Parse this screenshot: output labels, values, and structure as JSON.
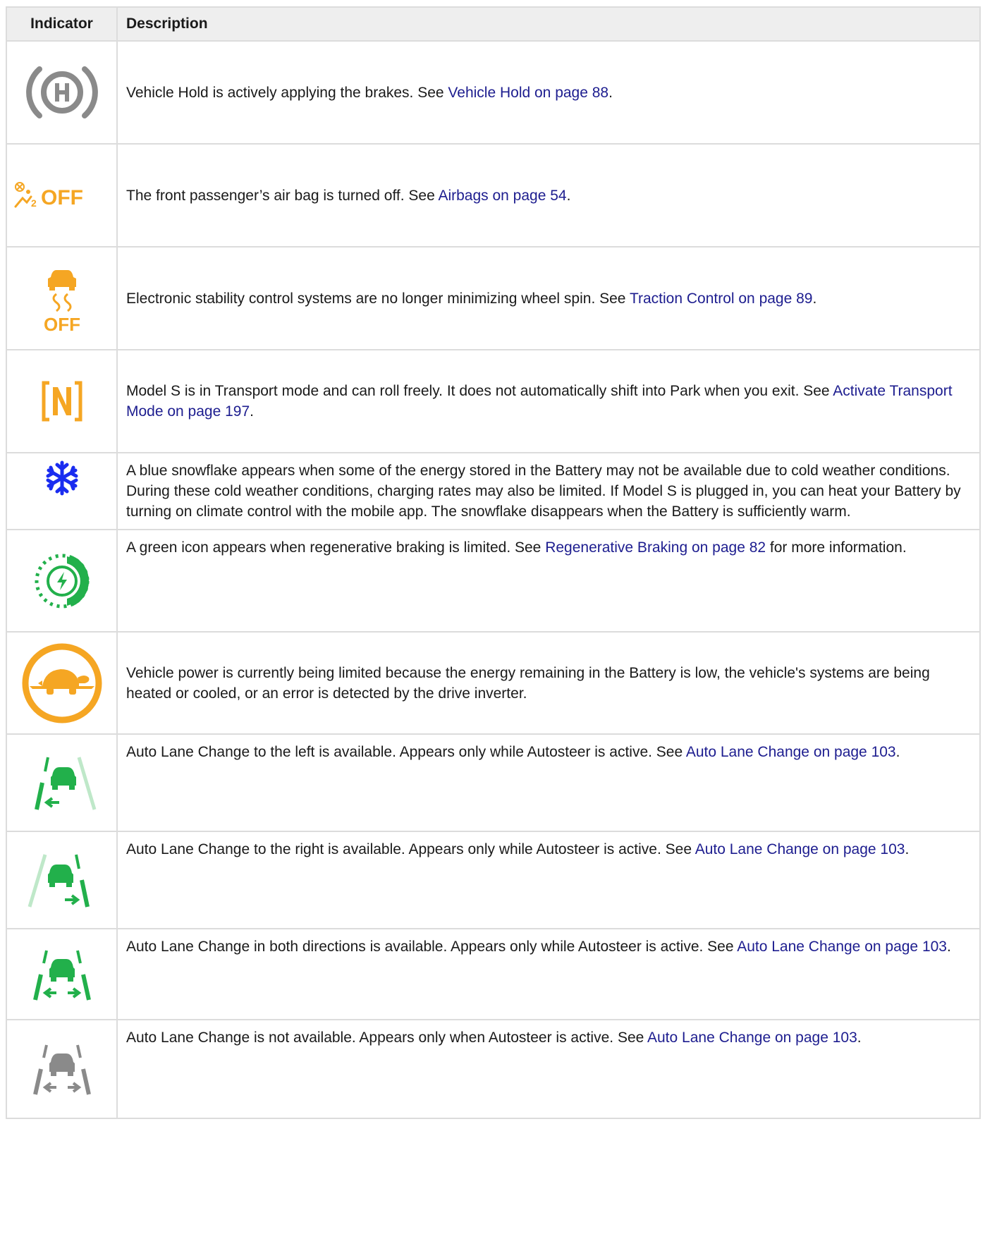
{
  "table": {
    "headers": {
      "indicator": "Indicator",
      "description": "Description"
    },
    "rows": [
      {
        "icon": "vehicle-hold-icon",
        "text": "Vehicle Hold is actively applying the brakes. See ",
        "link": "Vehicle Hold on page 88",
        "after": "."
      },
      {
        "icon": "passenger-airbag-off-icon",
        "icon_text": "OFF",
        "text": "The front passenger’s air bag is turned off. See ",
        "link": "Airbags on page 54",
        "after": "."
      },
      {
        "icon": "traction-control-off-icon",
        "icon_text": "OFF",
        "text": "Electronic stability control systems are no longer minimizing wheel spin. See ",
        "link": "Traction Control on page 89",
        "after": "."
      },
      {
        "icon": "transport-mode-icon",
        "icon_text": "[N]",
        "text": "Model S is in Transport mode and can roll freely. It does not automatically shift into Park when you exit. See ",
        "link": "Activate Transport Mode on page 197",
        "after": "."
      },
      {
        "icon": "snowflake-icon",
        "text": "A blue snowflake appears when some of the energy stored in the Battery may not be available due to cold weather conditions. During these cold weather conditions, charging rates may also be limited. If Model S is plugged in, you can heat your Battery by turning on climate control with the mobile app. The snowflake disappears when the Battery is sufficiently warm.",
        "link": "",
        "after": ""
      },
      {
        "icon": "regen-braking-limited-icon",
        "text": "A green icon appears when regenerative braking is limited. See ",
        "link": "Regenerative Braking on page 82",
        "after": " for more information."
      },
      {
        "icon": "power-limited-turtle-icon",
        "text": "Vehicle power is currently being limited because the energy remaining in the Battery is low, the vehicle's systems are being heated or cooled, or an error is detected by the drive inverter.",
        "link": "",
        "after": ""
      },
      {
        "icon": "lane-change-left-icon",
        "text": "Auto Lane Change to the left is available. Appears only while Autosteer is active. See ",
        "link": "Auto Lane Change on page 103",
        "after": "."
      },
      {
        "icon": "lane-change-right-icon",
        "text": "Auto Lane Change to the right is available. Appears only while Autosteer is active. See ",
        "link": "Auto Lane Change on page 103",
        "after": "."
      },
      {
        "icon": "lane-change-both-icon",
        "text": "Auto Lane Change in both directions is available. Appears only while Autosteer is active. See ",
        "link": "Auto Lane Change on page 103",
        "after": "."
      },
      {
        "icon": "lane-change-unavailable-icon",
        "text": "Auto Lane Change is not available. Appears only when Autosteer is active. See ",
        "link": "Auto Lane Change on page 103",
        "after": "."
      }
    ]
  },
  "colors": {
    "gray_icon": "#8a8a8a",
    "amber": "#f5a623",
    "blue": "#1a2cf0",
    "green": "#22b04b",
    "link": "#1d1d8f",
    "header_bg": "#eeeeee",
    "border": "#dcdcdc"
  }
}
